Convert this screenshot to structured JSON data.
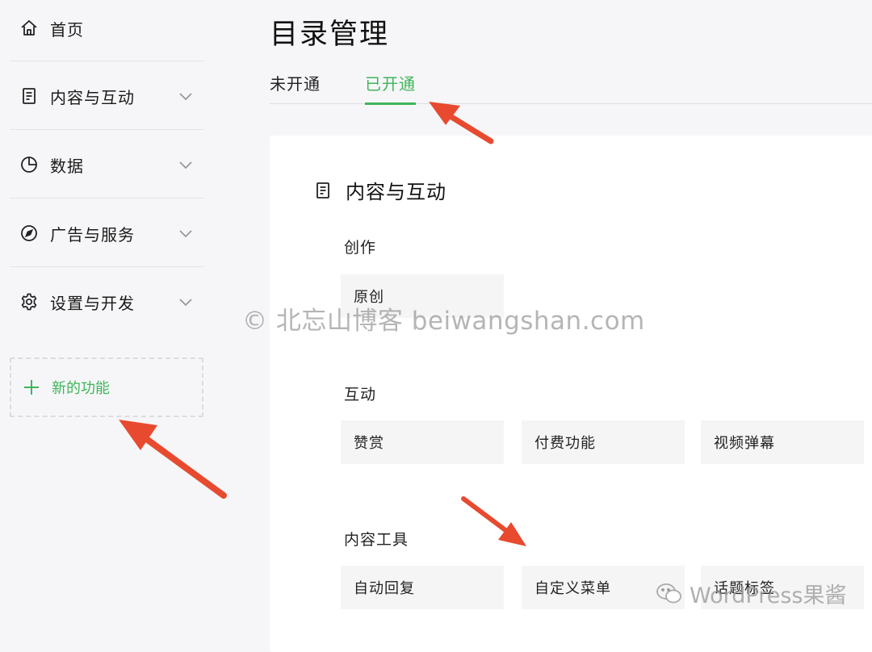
{
  "sidebar": {
    "items": [
      {
        "label": "首页",
        "icon": "home-icon",
        "expandable": false
      },
      {
        "label": "内容与互动",
        "icon": "document-icon",
        "expandable": true
      },
      {
        "label": "数据",
        "icon": "pie-chart-icon",
        "expandable": true
      },
      {
        "label": "广告与服务",
        "icon": "compass-icon",
        "expandable": true
      },
      {
        "label": "设置与开发",
        "icon": "gear-icon",
        "expandable": true
      }
    ],
    "new_feature": {
      "label": "新的功能",
      "icon": "plus-icon"
    }
  },
  "main": {
    "title": "目录管理",
    "tabs": [
      {
        "label": "未开通",
        "active": false
      },
      {
        "label": "已开通",
        "active": true
      }
    ],
    "section": {
      "title": "内容与互动",
      "icon": "document-icon",
      "groups": [
        {
          "title": "创作",
          "items": [
            "原创"
          ]
        },
        {
          "title": "互动",
          "items": [
            "赞赏",
            "付费功能",
            "视频弹幕"
          ]
        },
        {
          "title": "内容工具",
          "items": [
            "自动回复",
            "自定义菜单",
            "话题标签"
          ]
        }
      ]
    }
  },
  "watermark": "© 北忘山博客 beiwangshan.com",
  "brand_mark": "WordPress果酱",
  "colors": {
    "accent": "#3fb55a",
    "arrow": "#e84a2f",
    "background": "#f6f6f8",
    "card": "#f5f5f6"
  }
}
